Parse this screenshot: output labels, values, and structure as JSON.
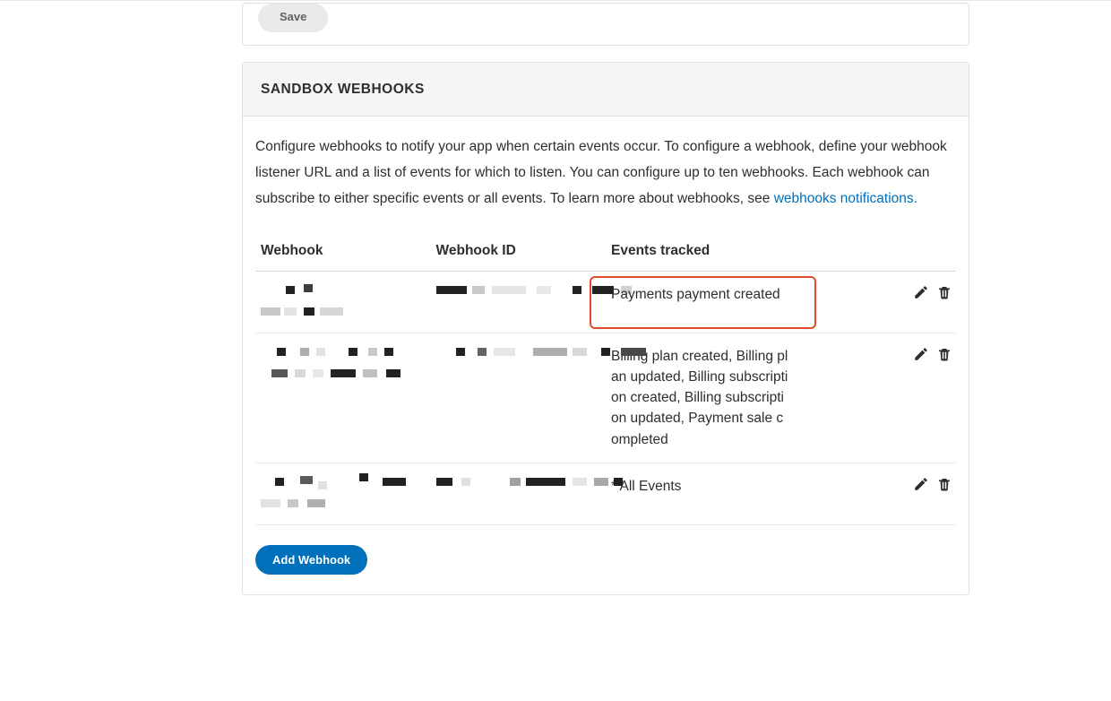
{
  "top_card": {
    "save_label": "Save"
  },
  "webhooks_card": {
    "header_title": "SANDBOX WEBHOOKS",
    "description_pre": "Configure webhooks to notify your app when certain events occur. To configure a webhook, define your webhook listener URL and a list of events for which to listen. You can configure up to ten webhooks. Each webhook can subscribe to either specific events or all events. To learn more about webhooks, see ",
    "description_link": "webhooks notifications.",
    "table": {
      "headers": {
        "webhook": "Webhook",
        "webhook_id": "Webhook ID",
        "events_tracked": "Events tracked"
      },
      "rows": [
        {
          "events": "Payments payment created",
          "highlighted": true
        },
        {
          "events": "Billing plan created, Billing plan updated, Billing subscription created, Billing subscription updated, Payment sale completed",
          "highlighted": false
        },
        {
          "events": "* All Events",
          "highlighted": false
        }
      ]
    },
    "add_webhook_label": "Add Webhook"
  },
  "icons": {
    "edit": "edit",
    "delete": "trash"
  },
  "colors": {
    "primary": "#0070ba",
    "highlight_border": "#e14b2a",
    "text": "#2c2e2f"
  }
}
